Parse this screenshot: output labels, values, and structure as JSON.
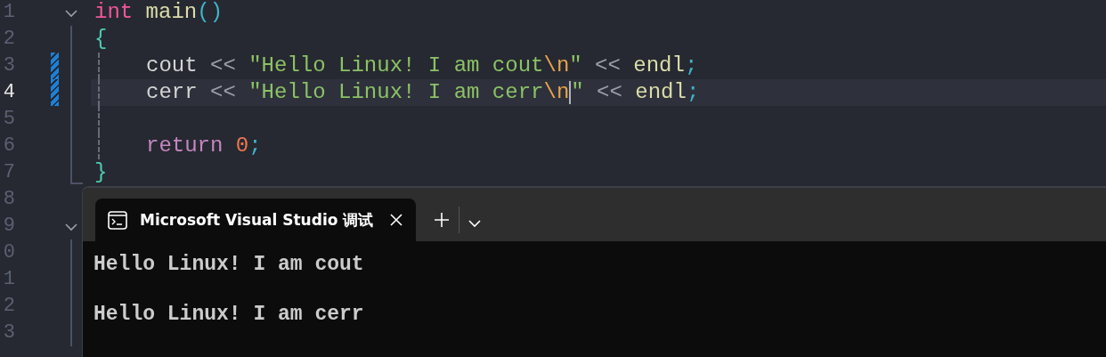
{
  "editor": {
    "lines": [
      {
        "number": "1",
        "expanded": true,
        "current": false,
        "modified": false,
        "indented": false,
        "tokens": [
          {
            "kind": "keyword",
            "text": "int"
          },
          {
            "kind": "function",
            "text": " main"
          },
          {
            "kind": "paren",
            "text": "()"
          }
        ],
        "children": [
          {
            "number": "2",
            "current": false,
            "modified": false,
            "indented": false,
            "tokens": [
              {
                "kind": "brace",
                "text": "{"
              }
            ]
          },
          {
            "number": "3",
            "current": false,
            "modified": true,
            "indented": true,
            "tokens": [
              {
                "kind": "ident",
                "text": "cout"
              },
              {
                "kind": "operator",
                "text": " << "
              },
              {
                "kind": "string",
                "text": "\"Hello Linux! I am cout"
              },
              {
                "kind": "escape",
                "text": "\\n",
                "caret_after": false
              },
              {
                "kind": "string",
                "text": "\""
              },
              {
                "kind": "operator",
                "text": " << "
              },
              {
                "kind": "function",
                "text": "endl"
              },
              {
                "kind": "semicolon",
                "text": ";"
              }
            ]
          },
          {
            "number": "4",
            "current": true,
            "modified": true,
            "indented": true,
            "tokens": [
              {
                "kind": "ident",
                "text": "cerr"
              },
              {
                "kind": "operator",
                "text": " << "
              },
              {
                "kind": "string",
                "text": "\"Hello Linux! I am cerr"
              },
              {
                "kind": "escape",
                "text": "\\n",
                "caret_after": true
              },
              {
                "kind": "string",
                "text": "\""
              },
              {
                "kind": "operator",
                "text": " << "
              },
              {
                "kind": "function",
                "text": "endl"
              },
              {
                "kind": "semicolon",
                "text": ";"
              }
            ]
          },
          {
            "number": "5",
            "current": false,
            "modified": false,
            "indented": true
          },
          {
            "number": "6",
            "current": false,
            "modified": false,
            "indented": true,
            "tokens": [
              {
                "kind": "control",
                "text": "return"
              },
              {
                "kind": "number",
                "text": " 0"
              },
              {
                "kind": "semicolon",
                "text": ";"
              }
            ]
          },
          {
            "number": "7",
            "current": false,
            "modified": false,
            "indented": false,
            "tokens": [
              {
                "kind": "brace",
                "text": "}"
              }
            ]
          }
        ]
      },
      {
        "number": "8",
        "current": false,
        "modified": false
      },
      {
        "number": "9",
        "expanded": true,
        "current": false,
        "modified": false,
        "children": [
          {
            "number": "0",
            "current": false,
            "modified": false
          },
          {
            "number": "1",
            "current": false,
            "modified": false
          },
          {
            "number": "2",
            "current": false,
            "modified": false
          },
          {
            "number": "3",
            "current": false,
            "modified": false
          }
        ]
      }
    ]
  },
  "terminal": {
    "tabs": [
      {
        "title": "Microsoft Visual Studio 调试",
        "selected": true
      }
    ],
    "output": [
      "Hello Linux! I am cout",
      "Hello Linux! I am cerr"
    ]
  }
}
